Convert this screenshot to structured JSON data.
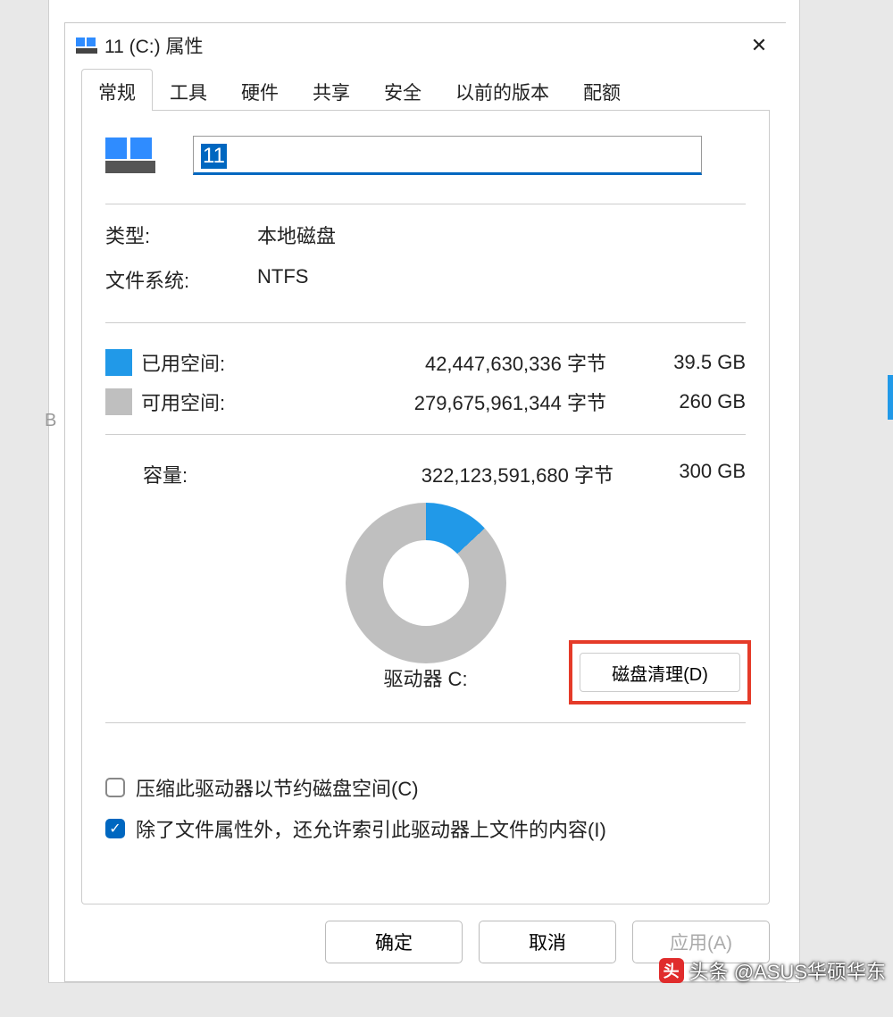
{
  "window": {
    "title": "11 (C:) 属性",
    "close_symbol": "✕"
  },
  "tabs": [
    "常规",
    "工具",
    "硬件",
    "共享",
    "安全",
    "以前的版本",
    "配额"
  ],
  "active_tab_index": 0,
  "drive": {
    "name_value": "11",
    "type_label": "类型:",
    "type_value": "本地磁盘",
    "fs_label": "文件系统:",
    "fs_value": "NTFS"
  },
  "space": {
    "used_label": "已用空间:",
    "used_bytes": "42,447,630,336 字节",
    "used_gb": "39.5 GB",
    "free_label": "可用空间:",
    "free_bytes": "279,675,961,344 字节",
    "free_gb": "260 GB",
    "cap_label": "容量:",
    "cap_bytes": "322,123,591,680 字节",
    "cap_gb": "300 GB"
  },
  "chart": {
    "drive_label": "驱动器 C:",
    "cleanup_button": "磁盘清理(D)"
  },
  "checks": {
    "compress_label": "压缩此驱动器以节约磁盘空间(C)",
    "compress_checked": false,
    "index_label": "除了文件属性外，还允许索引此驱动器上文件的内容(I)",
    "index_checked": true
  },
  "buttons": {
    "ok": "确定",
    "cancel": "取消",
    "apply": "应用(A)"
  },
  "watermark": "头条 @ASUS华硕华东",
  "chart_data": {
    "type": "pie",
    "title": "驱动器 C:",
    "series": [
      {
        "name": "已用空间",
        "value_bytes": 42447630336,
        "value_gb": 39.5,
        "color": "#2199e8"
      },
      {
        "name": "可用空间",
        "value_bytes": 279675961344,
        "value_gb": 260,
        "color": "#bfbfbf"
      }
    ],
    "total_bytes": 322123591680,
    "total_gb": 300
  },
  "colors": {
    "accent": "#0067c0",
    "used": "#2199e8",
    "free": "#bfbfbf",
    "highlight_box": "#e53b29"
  }
}
